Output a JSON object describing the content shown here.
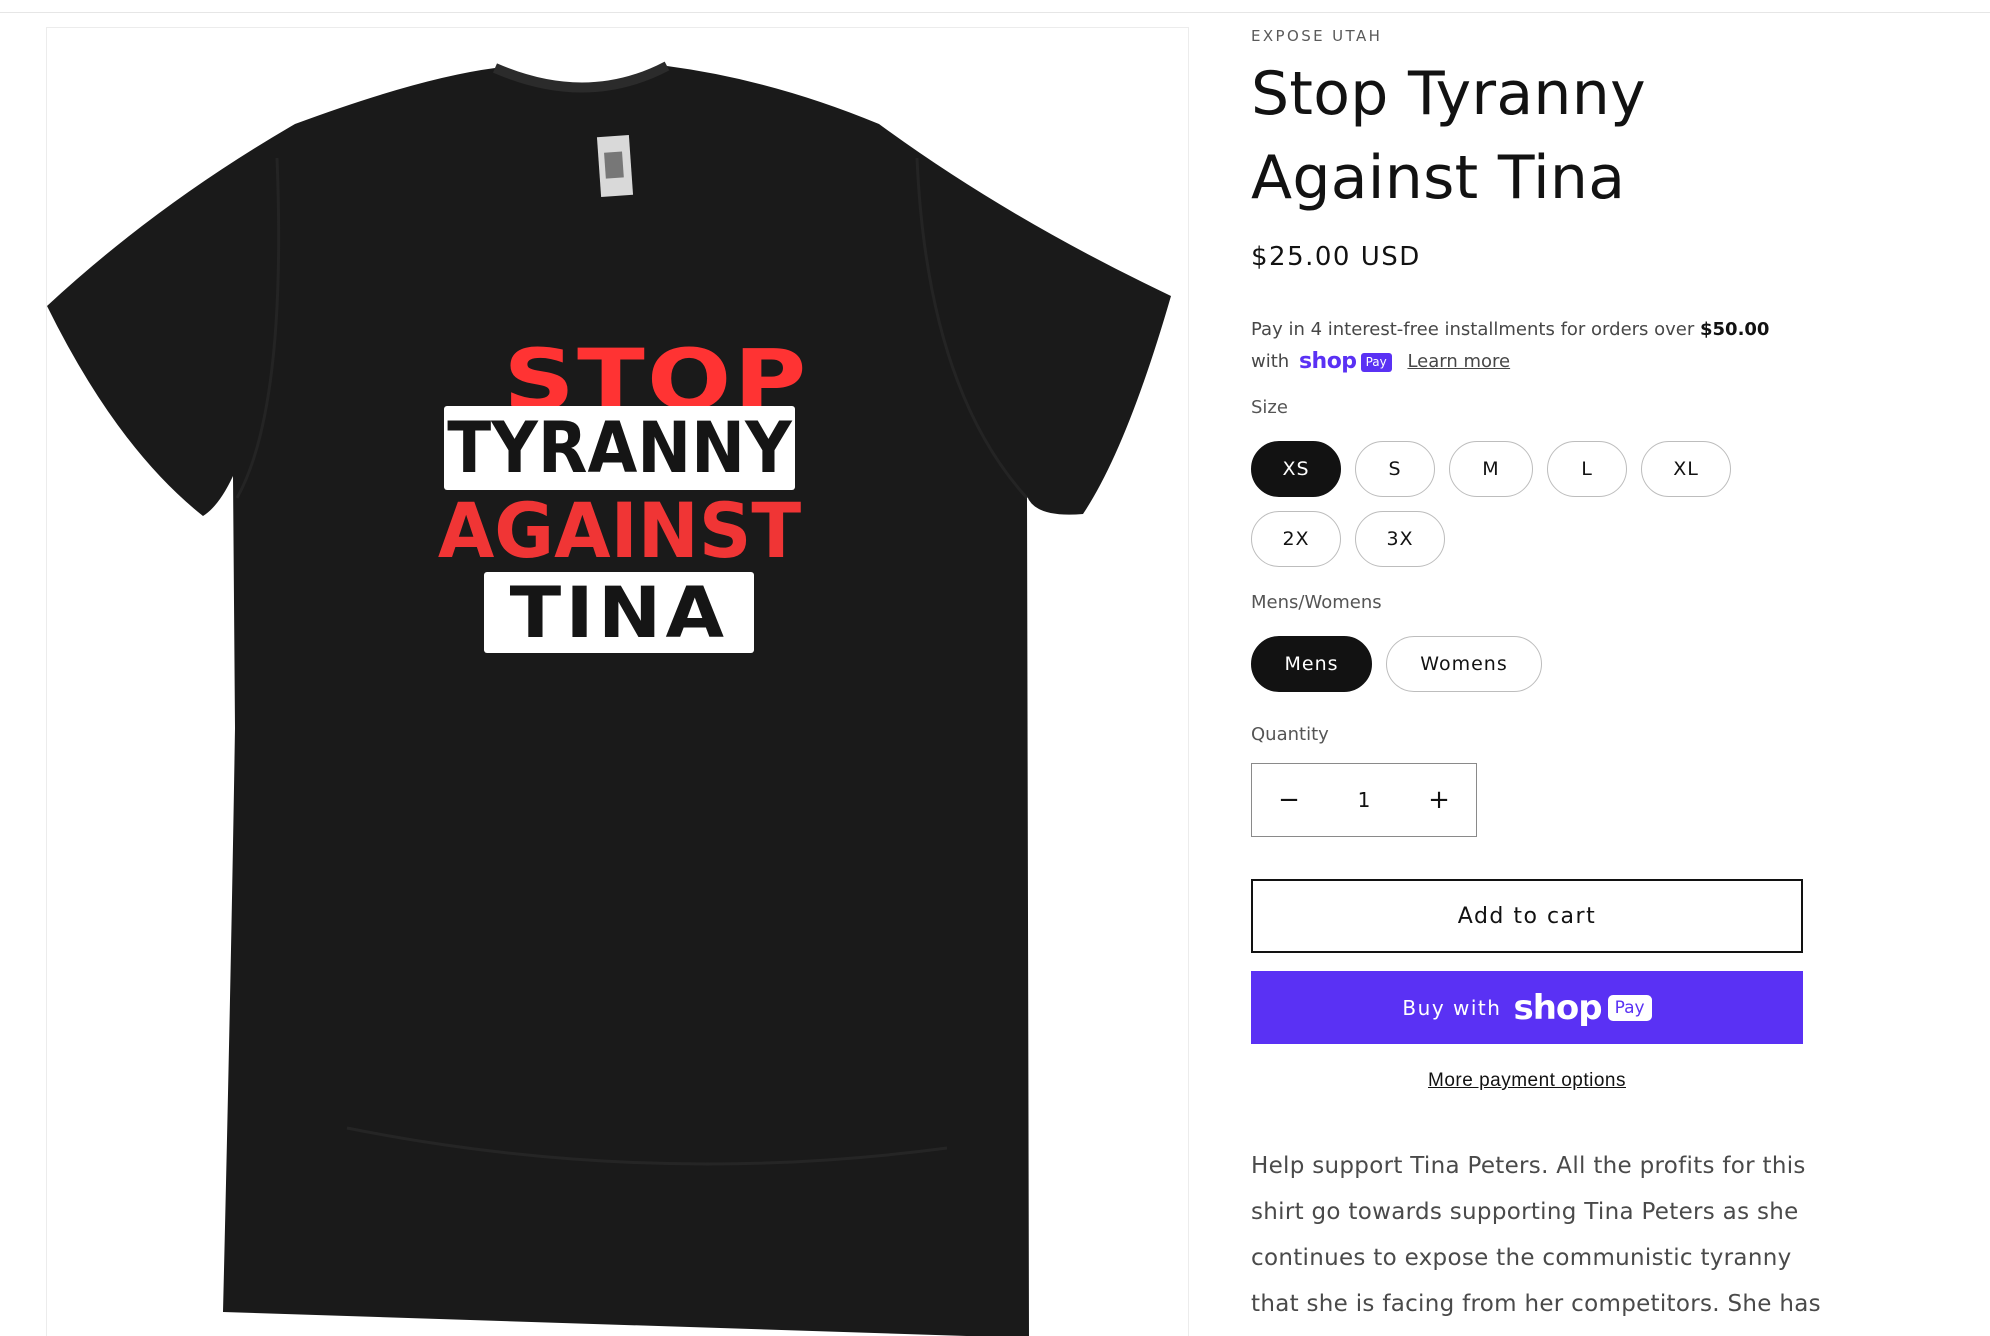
{
  "product": {
    "vendor": "EXPOSE UTAH",
    "title": "Stop Tyranny Against Tina",
    "price": "$25.00 USD",
    "image": {
      "print_lines": [
        "STOP",
        "TYRANNY",
        "AGAINST",
        "TINA"
      ]
    }
  },
  "installments": {
    "text_before": "Pay in 4 interest-free installments for orders over ",
    "threshold": "$50.00",
    "with": "with",
    "shop_word": "shop",
    "pay_chip": "Pay",
    "learn_more": "Learn more"
  },
  "options": {
    "size": {
      "label": "Size",
      "values": [
        "XS",
        "S",
        "M",
        "L",
        "XL",
        "2X",
        "3X"
      ],
      "selected": "XS"
    },
    "gender": {
      "label": "Mens/Womens",
      "values": [
        "Mens",
        "Womens"
      ],
      "selected": "Mens"
    }
  },
  "quantity": {
    "label": "Quantity",
    "value": "1",
    "decrease_glyph": "−",
    "increase_glyph": "+"
  },
  "actions": {
    "add_to_cart": "Add to cart",
    "buy_with": "Buy with",
    "buy_shop_word": "shop",
    "buy_pay_chip": "Pay",
    "more_payment": "More payment options"
  },
  "description": "Help support Tina Peters. All the profits for this shirt go towards supporting Tina Peters as she continues to expose the communistic tyranny that she is facing from her competitors. She has",
  "colors": {
    "shop_pay_purple": "#5a31f4",
    "selected_pill": "#121212",
    "print_red": "#ff3333",
    "shirt_black": "#1a1a1a"
  }
}
